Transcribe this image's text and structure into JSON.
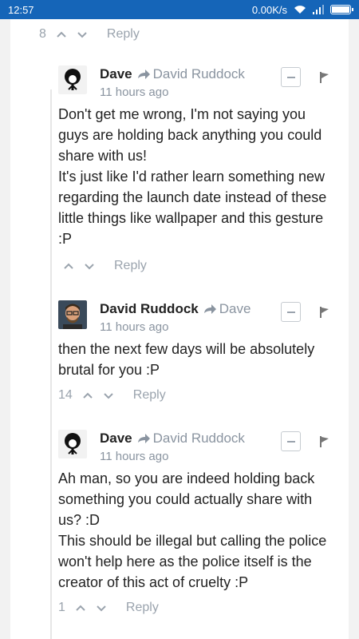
{
  "status_bar": {
    "time": "12:57",
    "speed": "0.00K/s",
    "battery_level": 0.9,
    "bar_color": "#1565b8"
  },
  "top_actions": {
    "count": "8",
    "reply": "Reply"
  },
  "comments": [
    {
      "author": "Dave",
      "reply_to": "David Ruddock",
      "time": "11 hours ago",
      "lines": [
        "Don't get me wrong, I'm not saying you",
        "guys are holding back anything you could",
        "share with us!",
        "It's just like I'd rather learn something new",
        "regarding the launch date instead of these",
        "little things like wallpaper and this gesture",
        ":P"
      ],
      "count": "",
      "reply": "Reply"
    },
    {
      "author": "David Ruddock",
      "reply_to": "Dave",
      "time": "11 hours ago",
      "lines": [
        "then the next few days will be absolutely",
        "brutal for you :P"
      ],
      "count": "14",
      "reply": "Reply"
    },
    {
      "author": "Dave",
      "reply_to": "David Ruddock",
      "time": "11 hours ago",
      "lines": [
        "Ah man, so you are indeed holding back",
        "something you could actually share with",
        "us? :D",
        "This should be illegal but calling the police",
        "won't help here as the police itself is the",
        "creator of this act of cruelty :P"
      ],
      "count": "1",
      "reply": "Reply"
    }
  ],
  "icons": {
    "arrow": "reply-arrow-icon",
    "collapse": "collapse-icon",
    "flag": "flag-icon",
    "upvote": "chevron-up-icon",
    "downvote": "chevron-down-icon"
  }
}
